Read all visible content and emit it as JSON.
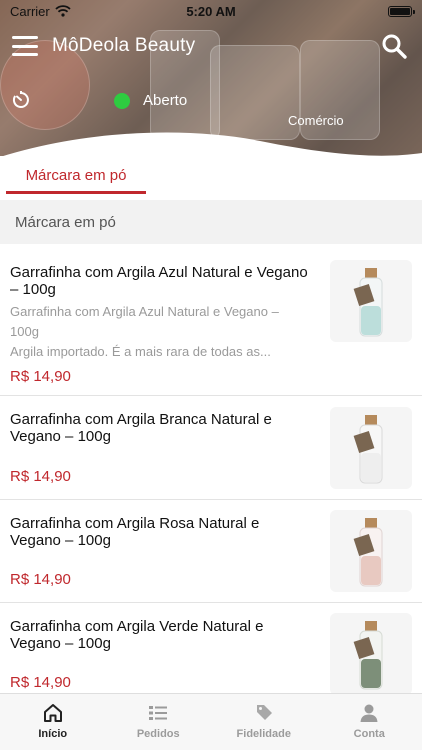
{
  "status_bar": {
    "carrier": "Carrier",
    "time": "5:20 AM"
  },
  "header": {
    "title": "MôDeola Beauty",
    "status": "Aberto",
    "status_color": "#2ecc40",
    "category": "Comércio"
  },
  "tabs": [
    {
      "label": "Márcara em pó",
      "active": true
    }
  ],
  "accent_color": "#c0282d",
  "section": {
    "title": "Márcara em pó"
  },
  "products": [
    {
      "name": "Garrafinha com Argila Azul Natural e Vegano – 100g",
      "description": "Garrafinha com Argila Azul Natural e Vegano – 100g\nArgila importado. É a mais rara de todas as...",
      "desc_line1": "Garrafinha com Argila Azul Natural e Vegano –",
      "desc_line2": "100g",
      "desc_line3": "Argila importado. É a mais rara de todas as...",
      "price": "R$ 14,90",
      "clay_color": "#bcdedb"
    },
    {
      "name": "Garrafinha com Argila Branca Natural e Vegano – 100g",
      "price": "R$ 14,90",
      "clay_color": "#eeeeee"
    },
    {
      "name": "Garrafinha com Argila Rosa Natural e Vegano – 100g",
      "price": "R$ 14,90",
      "clay_color": "#e8c9c1"
    },
    {
      "name": "Garrafinha com Argila Verde Natural e Vegano – 100g",
      "price": "R$ 14,90",
      "clay_color": "#7d8f79"
    }
  ],
  "bottom_nav": [
    {
      "label": "Início",
      "icon": "home-icon",
      "active": true
    },
    {
      "label": "Pedidos",
      "icon": "orders-icon",
      "active": false
    },
    {
      "label": "Fidelidade",
      "icon": "loyalty-tag-icon",
      "active": false
    },
    {
      "label": "Conta",
      "icon": "account-icon",
      "active": false
    }
  ]
}
